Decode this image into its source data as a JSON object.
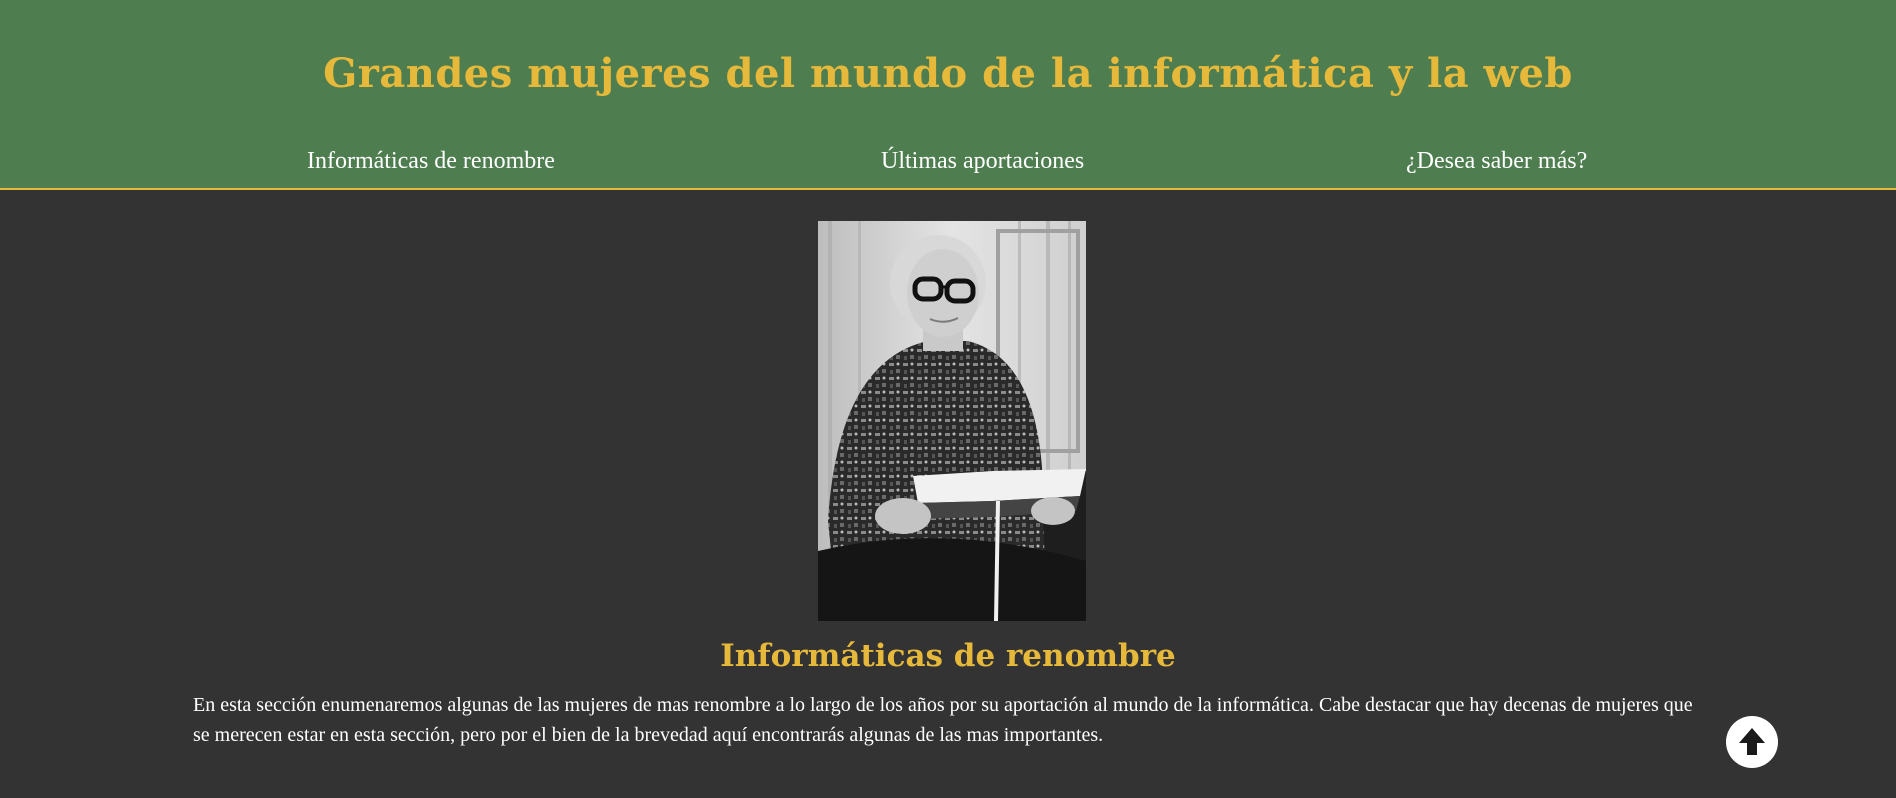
{
  "header": {
    "title": "Grandes mujeres del mundo de la informática y la web",
    "nav": [
      {
        "label": "Informáticas de renombre"
      },
      {
        "label": "Últimas aportaciones"
      },
      {
        "label": "¿Desea saber más?"
      }
    ]
  },
  "main": {
    "portrait_icon": "portrait-photo-woman-reading",
    "section": {
      "heading": "Informáticas de renombre",
      "text": "En esta sección enumenaremos algunas de las mujeres de mas renombre a lo largo de los años por su aportación al mundo de la informática. Cabe destacar que hay decenas de mujeres que se merecen estar en esta sección, pero por el bien de la brevedad aquí encontrarás algunas de las mas importantes."
    }
  },
  "back_to_top": {
    "icon": "arrow-up-icon"
  },
  "colors": {
    "header_bg": "#4e7e4f",
    "accent": "#e7b93a",
    "page_bg": "#333333",
    "text": "#ffffff"
  }
}
